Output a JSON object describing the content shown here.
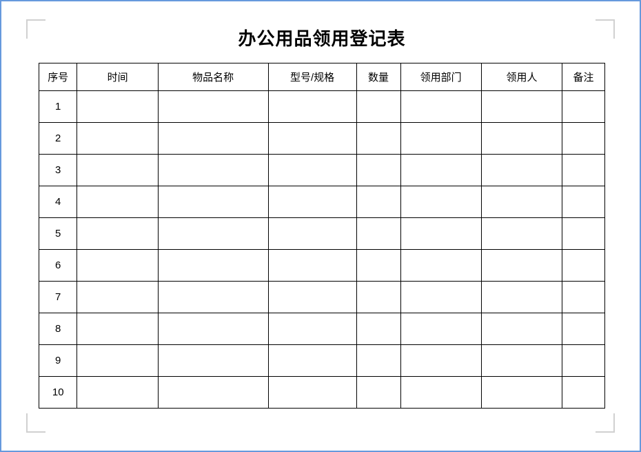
{
  "title": "办公用品领用登记表",
  "columns": {
    "seq": "序号",
    "time": "时间",
    "item": "物品名称",
    "model": "型号/规格",
    "qty": "数量",
    "dept": "领用部门",
    "person": "领用人",
    "note": "备注"
  },
  "rows": [
    {
      "seq": "1",
      "time": "",
      "item": "",
      "model": "",
      "qty": "",
      "dept": "",
      "person": "",
      "note": ""
    },
    {
      "seq": "2",
      "time": "",
      "item": "",
      "model": "",
      "qty": "",
      "dept": "",
      "person": "",
      "note": ""
    },
    {
      "seq": "3",
      "time": "",
      "item": "",
      "model": "",
      "qty": "",
      "dept": "",
      "person": "",
      "note": ""
    },
    {
      "seq": "4",
      "time": "",
      "item": "",
      "model": "",
      "qty": "",
      "dept": "",
      "person": "",
      "note": ""
    },
    {
      "seq": "5",
      "time": "",
      "item": "",
      "model": "",
      "qty": "",
      "dept": "",
      "person": "",
      "note": ""
    },
    {
      "seq": "6",
      "time": "",
      "item": "",
      "model": "",
      "qty": "",
      "dept": "",
      "person": "",
      "note": ""
    },
    {
      "seq": "7",
      "time": "",
      "item": "",
      "model": "",
      "qty": "",
      "dept": "",
      "person": "",
      "note": ""
    },
    {
      "seq": "8",
      "time": "",
      "item": "",
      "model": "",
      "qty": "",
      "dept": "",
      "person": "",
      "note": ""
    },
    {
      "seq": "9",
      "time": "",
      "item": "",
      "model": "",
      "qty": "",
      "dept": "",
      "person": "",
      "note": ""
    },
    {
      "seq": "10",
      "time": "",
      "item": "",
      "model": "",
      "qty": "",
      "dept": "",
      "person": "",
      "note": ""
    }
  ]
}
